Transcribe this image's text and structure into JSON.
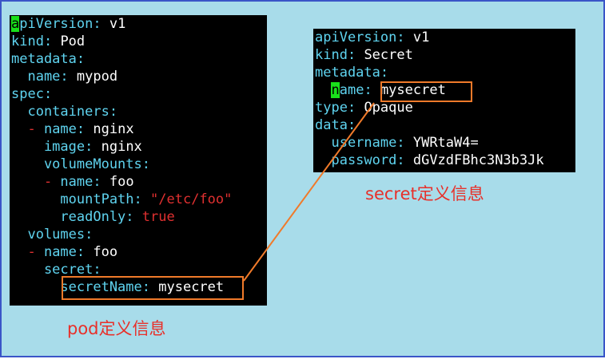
{
  "pod_yaml": {
    "lines": [
      {
        "parts": [
          {
            "t": "a",
            "c": "cur"
          },
          {
            "t": "piVersion",
            "c": "k"
          },
          {
            "t": ": ",
            "c": "k"
          },
          {
            "t": "v1",
            "c": "v"
          }
        ]
      },
      {
        "parts": [
          {
            "t": "kind",
            "c": "k"
          },
          {
            "t": ": ",
            "c": "k"
          },
          {
            "t": "Pod",
            "c": "v"
          }
        ]
      },
      {
        "parts": [
          {
            "t": "metadata",
            "c": "k"
          },
          {
            "t": ":",
            "c": "k"
          }
        ]
      },
      {
        "parts": [
          {
            "t": "  name",
            "c": "k"
          },
          {
            "t": ": ",
            "c": "k"
          },
          {
            "t": "mypod",
            "c": "v"
          }
        ]
      },
      {
        "parts": [
          {
            "t": "spec",
            "c": "k"
          },
          {
            "t": ":",
            "c": "k"
          }
        ]
      },
      {
        "parts": [
          {
            "t": "  containers",
            "c": "k"
          },
          {
            "t": ":",
            "c": "k"
          }
        ]
      },
      {
        "parts": [
          {
            "t": "  - ",
            "c": "s"
          },
          {
            "t": "name",
            "c": "k"
          },
          {
            "t": ": ",
            "c": "k"
          },
          {
            "t": "nginx",
            "c": "v"
          }
        ]
      },
      {
        "parts": [
          {
            "t": "    image",
            "c": "k"
          },
          {
            "t": ": ",
            "c": "k"
          },
          {
            "t": "nginx",
            "c": "v"
          }
        ]
      },
      {
        "parts": [
          {
            "t": "    volumeMounts",
            "c": "k"
          },
          {
            "t": ":",
            "c": "k"
          }
        ]
      },
      {
        "parts": [
          {
            "t": "    - ",
            "c": "s"
          },
          {
            "t": "name",
            "c": "k"
          },
          {
            "t": ": ",
            "c": "k"
          },
          {
            "t": "foo",
            "c": "v"
          }
        ]
      },
      {
        "parts": [
          {
            "t": "      mountPath",
            "c": "k"
          },
          {
            "t": ": ",
            "c": "k"
          },
          {
            "t": "\"/etc/foo\"",
            "c": "s"
          }
        ]
      },
      {
        "parts": [
          {
            "t": "      readOnly",
            "c": "k"
          },
          {
            "t": ": ",
            "c": "k"
          },
          {
            "t": "true",
            "c": "s"
          }
        ]
      },
      {
        "parts": [
          {
            "t": "  volumes",
            "c": "k"
          },
          {
            "t": ":",
            "c": "k"
          }
        ]
      },
      {
        "parts": [
          {
            "t": "  - ",
            "c": "s"
          },
          {
            "t": "name",
            "c": "k"
          },
          {
            "t": ": ",
            "c": "k"
          },
          {
            "t": "foo",
            "c": "v"
          }
        ]
      },
      {
        "parts": [
          {
            "t": "    secret",
            "c": "k"
          },
          {
            "t": ":",
            "c": "k"
          }
        ]
      },
      {
        "parts": [
          {
            "t": "      secretName",
            "c": "k"
          },
          {
            "t": ": ",
            "c": "k"
          },
          {
            "t": "mysecret",
            "c": "v"
          }
        ]
      }
    ]
  },
  "secret_yaml": {
    "lines": [
      {
        "parts": [
          {
            "t": "apiVersion",
            "c": "k"
          },
          {
            "t": ": ",
            "c": "k"
          },
          {
            "t": "v1",
            "c": "v"
          }
        ]
      },
      {
        "parts": [
          {
            "t": "kind",
            "c": "k"
          },
          {
            "t": ": ",
            "c": "k"
          },
          {
            "t": "Secret",
            "c": "v"
          }
        ]
      },
      {
        "parts": [
          {
            "t": "metadata",
            "c": "k"
          },
          {
            "t": ":",
            "c": "k"
          }
        ]
      },
      {
        "parts": [
          {
            "t": "  ",
            "c": "k"
          },
          {
            "t": "n",
            "c": "cur"
          },
          {
            "t": "ame",
            "c": "k"
          },
          {
            "t": ": ",
            "c": "k"
          },
          {
            "t": "mysecret",
            "c": "v"
          }
        ]
      },
      {
        "parts": [
          {
            "t": "type",
            "c": "k"
          },
          {
            "t": ": ",
            "c": "k"
          },
          {
            "t": "Opaque",
            "c": "v"
          }
        ]
      },
      {
        "parts": [
          {
            "t": "data",
            "c": "k"
          },
          {
            "t": ":",
            "c": "k"
          }
        ]
      },
      {
        "parts": [
          {
            "t": "  username",
            "c": "k"
          },
          {
            "t": ": ",
            "c": "k"
          },
          {
            "t": "YWRtaW4=",
            "c": "v"
          }
        ]
      },
      {
        "parts": [
          {
            "t": "  password",
            "c": "k"
          },
          {
            "t": ": ",
            "c": "k"
          },
          {
            "t": "dGVzdFBhc3N3b3Jk",
            "c": "v"
          }
        ]
      }
    ]
  },
  "captions": {
    "secret": "secret定义信息",
    "pod": "pod定义信息"
  },
  "colors": {
    "background": "#a8dcea",
    "border": "#3a55c8",
    "terminal_bg": "#000000",
    "yaml_key": "#5fd4f0",
    "yaml_value": "#ffffff",
    "yaml_string": "#e03030",
    "cursor": "#19e01a",
    "highlight": "#f07a2a",
    "caption": "#e8302a"
  }
}
